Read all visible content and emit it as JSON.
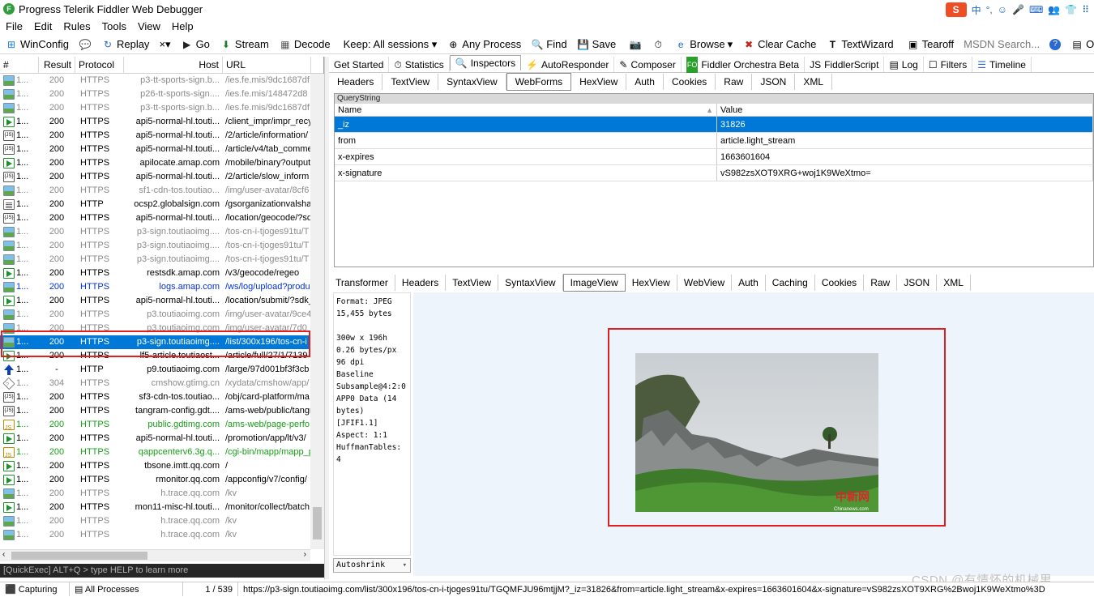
{
  "window": {
    "title": "Progress Telerik Fiddler Web Debugger",
    "app_icon": "F"
  },
  "ime": {
    "items": [
      "中",
      "°,",
      "☺",
      "🎤",
      "⌨",
      "👥",
      "👕",
      "⠿"
    ]
  },
  "menu": [
    "File",
    "Edit",
    "Rules",
    "Tools",
    "View",
    "Help"
  ],
  "toolbar": {
    "winconfig": "WinConfig",
    "replay": "Replay",
    "remove": "×▾",
    "go": "Go",
    "stream": "Stream",
    "decode": "Decode",
    "keep": "Keep: All sessions ▾",
    "any_process": "Any Process",
    "find": "Find",
    "save": "Save",
    "browse": "Browse",
    "clear_cache": "Clear Cache",
    "textwizard": "TextWizard",
    "tearoff": "Tearoff",
    "msdn": "MSDN Search...",
    "online": "Online"
  },
  "session_columns": [
    "#",
    "Result",
    "Protocol",
    "Host",
    "URL"
  ],
  "sessions": [
    {
      "icon": "img",
      "num": "1...",
      "result": "200",
      "protocol": "HTTPS",
      "host": "p3-tt-sports-sign.b...",
      "url": "/ies.fe.mis/9dc1687df",
      "color": "gray"
    },
    {
      "icon": "img",
      "num": "1...",
      "result": "200",
      "protocol": "HTTPS",
      "host": "p26-tt-sports-sign....",
      "url": "/ies.fe.mis/148472d8",
      "color": "gray"
    },
    {
      "icon": "img",
      "num": "1...",
      "result": "200",
      "protocol": "HTTPS",
      "host": "p3-tt-sports-sign.b...",
      "url": "/ies.fe.mis/9dc1687df",
      "color": "gray"
    },
    {
      "icon": "arr",
      "num": "1...",
      "result": "200",
      "protocol": "HTTPS",
      "host": "api5-normal-hl.touti...",
      "url": "/client_impr/impr_recy",
      "color": "normal"
    },
    {
      "icon": "js",
      "num": "1...",
      "result": "200",
      "protocol": "HTTPS",
      "host": "api5-normal-hl.touti...",
      "url": "/2/article/information/",
      "color": "normal"
    },
    {
      "icon": "js",
      "num": "1...",
      "result": "200",
      "protocol": "HTTPS",
      "host": "api5-normal-hl.touti...",
      "url": "/article/v4/tab_comme",
      "color": "normal"
    },
    {
      "icon": "arr",
      "num": "1...",
      "result": "200",
      "protocol": "HTTPS",
      "host": "apilocate.amap.com",
      "url": "/mobile/binary?output",
      "color": "normal"
    },
    {
      "icon": "js",
      "num": "1...",
      "result": "200",
      "protocol": "HTTPS",
      "host": "api5-normal-hl.touti...",
      "url": "/2/article/slow_inform",
      "color": "normal"
    },
    {
      "icon": "img",
      "num": "1...",
      "result": "200",
      "protocol": "HTTPS",
      "host": "sf1-cdn-tos.toutiao...",
      "url": "/img/user-avatar/8cf6",
      "color": "gray"
    },
    {
      "icon": "doc",
      "num": "1...",
      "result": "200",
      "protocol": "HTTP",
      "host": "ocsp2.globalsign.com",
      "url": "/gsorganizationvalsha",
      "color": "normal"
    },
    {
      "icon": "js",
      "num": "1...",
      "result": "200",
      "protocol": "HTTPS",
      "host": "api5-normal-hl.touti...",
      "url": "/location/geocode/?sd",
      "color": "normal"
    },
    {
      "icon": "img",
      "num": "1...",
      "result": "200",
      "protocol": "HTTPS",
      "host": "p3-sign.toutiaoimg....",
      "url": "/tos-cn-i-tjoges91tu/T",
      "color": "gray"
    },
    {
      "icon": "img",
      "num": "1...",
      "result": "200",
      "protocol": "HTTPS",
      "host": "p3-sign.toutiaoimg....",
      "url": "/tos-cn-i-tjoges91tu/T",
      "color": "gray"
    },
    {
      "icon": "img",
      "num": "1...",
      "result": "200",
      "protocol": "HTTPS",
      "host": "p3-sign.toutiaoimg....",
      "url": "/tos-cn-i-tjoges91tu/T",
      "color": "gray"
    },
    {
      "icon": "arr",
      "num": "1...",
      "result": "200",
      "protocol": "HTTPS",
      "host": "restsdk.amap.com",
      "url": "/v3/geocode/regeo",
      "color": "normal"
    },
    {
      "icon": "img",
      "num": "1...",
      "result": "200",
      "protocol": "HTTPS",
      "host": "logs.amap.com",
      "url": "/ws/log/upload?produ",
      "color": "blue"
    },
    {
      "icon": "arr",
      "num": "1...",
      "result": "200",
      "protocol": "HTTPS",
      "host": "api5-normal-hl.touti...",
      "url": "/location/submit/?sdk_",
      "color": "normal"
    },
    {
      "icon": "img",
      "num": "1...",
      "result": "200",
      "protocol": "HTTPS",
      "host": "p3.toutiaoimg.com",
      "url": "/img/user-avatar/9ce4",
      "color": "gray"
    },
    {
      "icon": "img",
      "num": "1...",
      "result": "200",
      "protocol": "HTTPS",
      "host": "p3.toutiaoimg.com",
      "url": "/img/user-avatar/7d0",
      "color": "gray"
    },
    {
      "icon": "img",
      "num": "1...",
      "result": "200",
      "protocol": "HTTPS",
      "host": "p3-sign.toutiaoimg....",
      "url": "/list/300x196/tos-cn-i",
      "color": "normal",
      "selected": true
    },
    {
      "icon": "arr",
      "num": "1...",
      "result": "200",
      "protocol": "HTTPS",
      "host": "lf5-article.toutiaost...",
      "url": "/article/full/27/1/7139",
      "color": "normal"
    },
    {
      "icon": "up",
      "num": "1...",
      "result": "-",
      "protocol": "HTTP",
      "host": "p9.toutiaoimg.com",
      "url": "/large/97d001bf3f3cb",
      "color": "normal"
    },
    {
      "icon": "dia",
      "num": "1...",
      "result": "304",
      "protocol": "HTTPS",
      "host": "cmshow.gtimg.cn",
      "url": "/xydata/cmshow/app/",
      "color": "gray"
    },
    {
      "icon": "js",
      "num": "1...",
      "result": "200",
      "protocol": "HTTPS",
      "host": "sf3-cdn-tos.toutiao...",
      "url": "/obj/card-platform/ma",
      "color": "normal"
    },
    {
      "icon": "js",
      "num": "1...",
      "result": "200",
      "protocol": "HTTPS",
      "host": "tangram-config.gdt....",
      "url": "/ams-web/public/tangr",
      "color": "normal"
    },
    {
      "icon": "jsa",
      "num": "1...",
      "result": "200",
      "protocol": "HTTPS",
      "host": "public.gdtimg.com",
      "url": "/ams-web/page-perfo",
      "color": "green"
    },
    {
      "icon": "arr",
      "num": "1...",
      "result": "200",
      "protocol": "HTTPS",
      "host": "api5-normal-hl.touti...",
      "url": "/promotion/app/lt/v3/",
      "color": "normal"
    },
    {
      "icon": "jsa",
      "num": "1...",
      "result": "200",
      "protocol": "HTTPS",
      "host": "qappcenterv6.3g.q...",
      "url": "/cgi-bin/mapp/mapp_p",
      "color": "green"
    },
    {
      "icon": "arr",
      "num": "1...",
      "result": "200",
      "protocol": "HTTPS",
      "host": "tbsone.imtt.qq.com",
      "url": "/",
      "color": "normal"
    },
    {
      "icon": "arr",
      "num": "1...",
      "result": "200",
      "protocol": "HTTPS",
      "host": "rmonitor.qq.com",
      "url": "/appconfig/v7/config/",
      "color": "normal"
    },
    {
      "icon": "img",
      "num": "1...",
      "result": "200",
      "protocol": "HTTPS",
      "host": "h.trace.qq.com",
      "url": "/kv",
      "color": "gray"
    },
    {
      "icon": "arr",
      "num": "1...",
      "result": "200",
      "protocol": "HTTPS",
      "host": "mon11-misc-hl.touti...",
      "url": "/monitor/collect/batch",
      "color": "normal"
    },
    {
      "icon": "img",
      "num": "1...",
      "result": "200",
      "protocol": "HTTPS",
      "host": "h.trace.qq.com",
      "url": "/kv",
      "color": "gray"
    },
    {
      "icon": "img",
      "num": "1...",
      "result": "200",
      "protocol": "HTTPS",
      "host": "h.trace.qq.com",
      "url": "/kv",
      "color": "gray"
    }
  ],
  "quickexec": "[QuickExec] ALT+Q > type HELP to learn more",
  "status": {
    "capturing": "Capturing",
    "processes": "All Processes",
    "count": "1 / 539",
    "url": "https://p3-sign.toutiaoimg.com/list/300x196/tos-cn-i-tjoges91tu/TGQMFJU96mtjjM?_iz=31826&from=article.light_stream&x-expires=1663601604&x-signature=vS982zsXOT9XRG%2Bwoj1K9WeXtmo%3D"
  },
  "top_tabs": [
    "Get Started",
    "Statistics",
    "Inspectors",
    "AutoResponder",
    "Composer",
    "Fiddler Orchestra Beta",
    "FiddlerScript",
    "Log",
    "Filters",
    "Timeline"
  ],
  "request_tabs": [
    "Headers",
    "TextView",
    "SyntaxView",
    "WebForms",
    "HexView",
    "Auth",
    "Cookies",
    "Raw",
    "JSON",
    "XML"
  ],
  "querystring": {
    "title": "QueryString",
    "col_name": "Name",
    "col_value": "Value",
    "rows": [
      {
        "name": "_iz",
        "value": "31826"
      },
      {
        "name": "from",
        "value": "article.light_stream"
      },
      {
        "name": "x-expires",
        "value": "1663601604"
      },
      {
        "name": "x-signature",
        "value": "vS982zsXOT9XRG+woj1K9WeXtmo="
      }
    ]
  },
  "response_tabs": [
    "Transformer",
    "Headers",
    "TextView",
    "SyntaxView",
    "ImageView",
    "HexView",
    "WebView",
    "Auth",
    "Caching",
    "Cookies",
    "Raw",
    "JSON",
    "XML"
  ],
  "image_info": "Format: JPEG\n15,455 bytes\n\n300w x 196h\n0.26 bytes/px\n96 dpi\nBaseline\nSubsample@4:2:0\nAPP0 Data (14\nbytes)\n[JFIF1.1]\nAspect: 1:1\nHuffmanTables:\n4",
  "autoshrink": "Autoshrink",
  "photo_watermark": {
    "cn": "中新网",
    "en": "Chinanews.com"
  },
  "watermark": "CSDN @有情怀的机械男",
  "colors": {
    "selection": "#0078d7",
    "highlight_box": "#e02020"
  }
}
